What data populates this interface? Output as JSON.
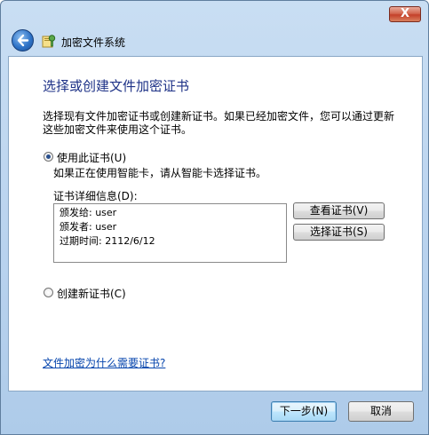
{
  "window": {
    "close_label": "X"
  },
  "nav": {
    "title": "加密文件系统"
  },
  "page": {
    "heading": "选择或创建文件加密证书",
    "description": "选择现有文件加密证书或创建新证书。如果已经加密文件，您可以通过更新这些加密文件来使用这个证书。"
  },
  "options": {
    "use_cert_label": "使用此证书(U)",
    "use_cert_hint": "如果正在使用智能卡，请从智能卡选择证书。",
    "create_cert_label": "创建新证书(C)"
  },
  "details": {
    "label": "证书详细信息(D):",
    "lines": [
      "颁发给: user",
      "颁发者: user",
      "过期时间: 2112/6/12"
    ]
  },
  "buttons": {
    "view_cert": "查看证书(V)",
    "select_cert": "选择证书(S)",
    "next": "下一步(N)",
    "cancel": "取消"
  },
  "help_link": "文件加密为什么需要证书?"
}
